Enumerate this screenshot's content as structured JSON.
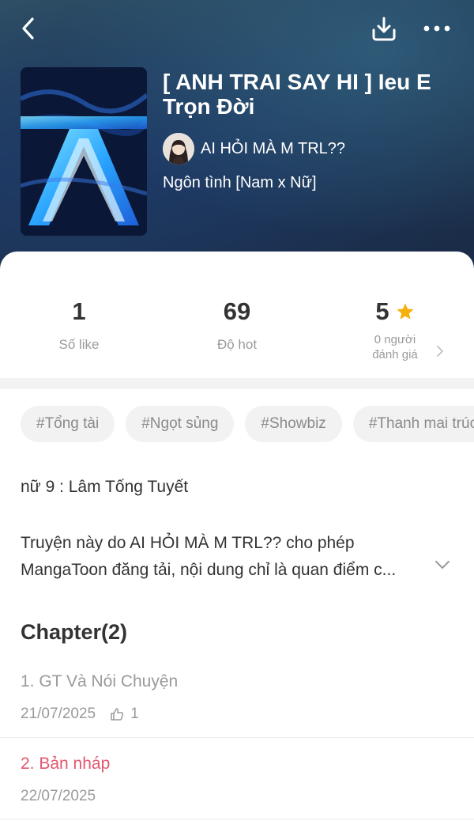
{
  "colors": {
    "accent_red": "#e2576f",
    "star": "#f5b00c",
    "header_bg": "#1d3552"
  },
  "topbar": {
    "back_icon": "chevron-left-icon",
    "download_icon": "download-icon",
    "more_icon": "more-horizontal-icon"
  },
  "story": {
    "title": "[ ANH TRAI SAY HI ] Ieu E Trọn Đời",
    "author": "AI HỎI MÀ M TRL??",
    "genre": "Ngôn tình [Nam x Nữ]"
  },
  "stats": {
    "likes": {
      "value": "1",
      "label": "Số like"
    },
    "hot": {
      "value": "69",
      "label": "Độ hot"
    },
    "rating": {
      "value": "5",
      "label_line1": "0 người",
      "label_line2": "đánh giá"
    }
  },
  "tags": [
    "#Tổng tài",
    "#Ngọt sủng",
    "#Showbiz",
    "#Thanh mai trúc mã"
  ],
  "description": {
    "line1": "nữ 9 : Lâm Tống Tuyết",
    "para_line1": "Truyện này do AI HỎI MÀ M TRL?? cho phép",
    "para_line2": "MangaToon đăng tải, nội dung chỉ là quan điểm c..."
  },
  "chapters": {
    "heading": "Chapter(2)",
    "items": [
      {
        "title": "1. GT Và Nói Chuyện",
        "date": "21/07/2025",
        "likes": "1"
      },
      {
        "title": "2. Bản nháp",
        "date": "22/07/2025"
      }
    ]
  }
}
